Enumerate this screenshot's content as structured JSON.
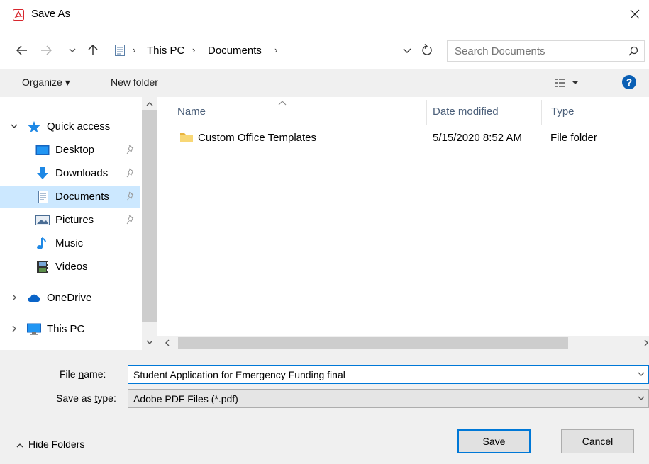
{
  "window": {
    "title": "Save As",
    "app_icon": "adobe-pdf-icon",
    "close_icon": "close-icon"
  },
  "address": {
    "crumbs": [
      "This PC",
      "Documents"
    ],
    "location_icon": "documents-icon"
  },
  "search": {
    "placeholder": "Search Documents"
  },
  "toolbar": {
    "organize_label": "Organize ▾",
    "new_folder_label": "New folder",
    "help_label": "?"
  },
  "nav": {
    "items": [
      {
        "label": "Quick access",
        "icon": "star-icon",
        "expander": "expanded",
        "pinned": false,
        "selected": false
      },
      {
        "label": "Desktop",
        "icon": "desktop-icon",
        "expander": "none",
        "pinned": true,
        "selected": false
      },
      {
        "label": "Downloads",
        "icon": "download-arrow-icon",
        "expander": "none",
        "pinned": true,
        "selected": false
      },
      {
        "label": "Documents",
        "icon": "documents-icon",
        "expander": "none",
        "pinned": true,
        "selected": true
      },
      {
        "label": "Pictures",
        "icon": "pictures-icon",
        "expander": "none",
        "pinned": true,
        "selected": false
      },
      {
        "label": "Music",
        "icon": "music-note-icon",
        "expander": "none",
        "pinned": false,
        "selected": false
      },
      {
        "label": "Videos",
        "icon": "film-icon",
        "expander": "none",
        "pinned": false,
        "selected": false
      },
      {
        "label": "OneDrive",
        "icon": "cloud-icon",
        "expander": "collapsed",
        "pinned": false,
        "selected": false
      },
      {
        "label": "This PC",
        "icon": "computer-icon",
        "expander": "collapsed",
        "pinned": false,
        "selected": false
      }
    ]
  },
  "files": {
    "columns": [
      "Name",
      "Date modified",
      "Type"
    ],
    "rows": [
      {
        "name": "Custom Office Templates",
        "date_modified": "5/15/2020 8:52 AM",
        "type": "File folder",
        "icon": "folder-icon"
      }
    ]
  },
  "form": {
    "file_name_label_pre": "File ",
    "file_name_label_u": "n",
    "file_name_label_post": "ame:",
    "file_name_value": "Student Application for Emergency Funding final",
    "save_type_label_pre": "Save as ",
    "save_type_label_u": "t",
    "save_type_label_post": "ype:",
    "save_type_value": "Adobe PDF Files (*.pdf)"
  },
  "footer": {
    "hide_folders_label": "Hide Folders",
    "save_label_u": "S",
    "save_label_rest": "ave",
    "cancel_label": "Cancel"
  },
  "colors": {
    "accent": "#0078d7",
    "selection": "#cce8ff",
    "panel": "#f0f0f0",
    "pdf_red": "#d7262d",
    "folder_yellow": "#f8d775"
  }
}
